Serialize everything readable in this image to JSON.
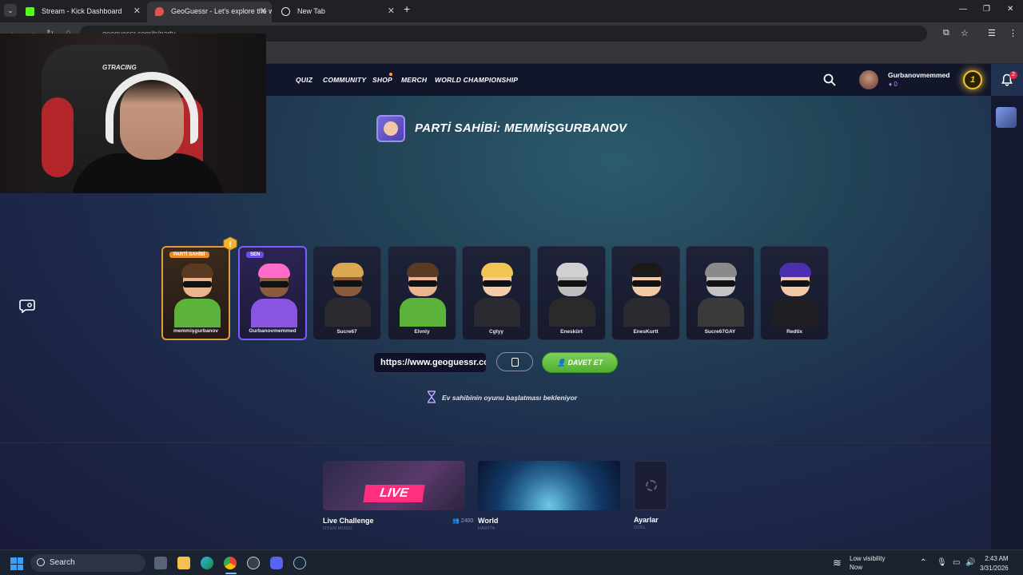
{
  "browser": {
    "tabs": [
      {
        "title": "Stream - Kick Dashboard",
        "favicon_color": "#53fc18",
        "active": false
      },
      {
        "title": "GeoGuessr - Let's explore the w",
        "favicon_color": "#e0544a",
        "active": true
      },
      {
        "title": "New Tab",
        "favicon_color": "#e8eaed",
        "active": false
      }
    ],
    "url": "geoguessr.com/tr/party"
  },
  "nav": {
    "links": [
      "QUIZ",
      "COMMUNITY",
      "SHOP",
      "MERCH",
      "WORLD CHAMPIONSHIP"
    ],
    "username": "Gurbanovmemmed",
    "coins": "0",
    "level": "1",
    "notifications": "2"
  },
  "party": {
    "title": "PARTİ SAHİBİ: MEMMİŞGURBANOV",
    "host_badge": "PARTİ SAHİBİ",
    "me_badge": "SEN",
    "members": [
      {
        "name": "memmişgurbanov",
        "skin": "#e9b48e",
        "hair": "#5a3a22",
        "shirt": "#5cb33a",
        "role": "host"
      },
      {
        "name": "Gurbanovmemmed",
        "skin": "#8a5a3e",
        "hair": "#ff6bc8",
        "shirt": "#8a55e0",
        "role": "me"
      },
      {
        "name": "Sucre67",
        "skin": "#8a5a3e",
        "hair": "#d9a850",
        "shirt": "#2a2a30",
        "role": ""
      },
      {
        "name": "Elvnly",
        "skin": "#e9b48e",
        "hair": "#5a3a22",
        "shirt": "#5cb33a",
        "role": ""
      },
      {
        "name": "Cgtyy",
        "skin": "#f3cba8",
        "hair": "#f1c552",
        "shirt": "#2a2a30",
        "role": ""
      },
      {
        "name": "Eneskürt",
        "skin": "#bcbcbc",
        "hair": "#d0d0d0",
        "shirt": "#2a2a2a",
        "role": ""
      },
      {
        "name": "EnesKurtt",
        "skin": "#f0c8a4",
        "hair": "#1a1a1a",
        "shirt": "#2a2a30",
        "role": ""
      },
      {
        "name": "Sucre67GAY",
        "skin": "#c4c4c4",
        "hair": "#8a8a8a",
        "shirt": "#3a3a3a",
        "role": ""
      },
      {
        "name": "Redtix",
        "skin": "#f0c8a4",
        "hair": "#4b2fb0",
        "shirt": "#1e1e24",
        "role": ""
      }
    ],
    "invite_url": "https://www.geoguessr.com/tr/party",
    "invite_button": "DAVET ET",
    "waiting_text": "Ev sahibinin oyunu başlatması bekleniyor"
  },
  "modes": [
    {
      "title": "Live Challenge",
      "subtitle": "OYUN MODU",
      "count": "2400",
      "tag": "LIVE"
    },
    {
      "title": "World",
      "subtitle": "HARİTA"
    },
    {
      "title": "Ayarlar",
      "subtitle": "ÖZEL"
    }
  ],
  "webcam": {
    "chair_brand": "GTRACING"
  },
  "taskbar": {
    "search": "Search",
    "weather_line1": "Low visibility",
    "weather_line2": "Now",
    "time": "2:43 AM",
    "date": "3/31/2026"
  }
}
